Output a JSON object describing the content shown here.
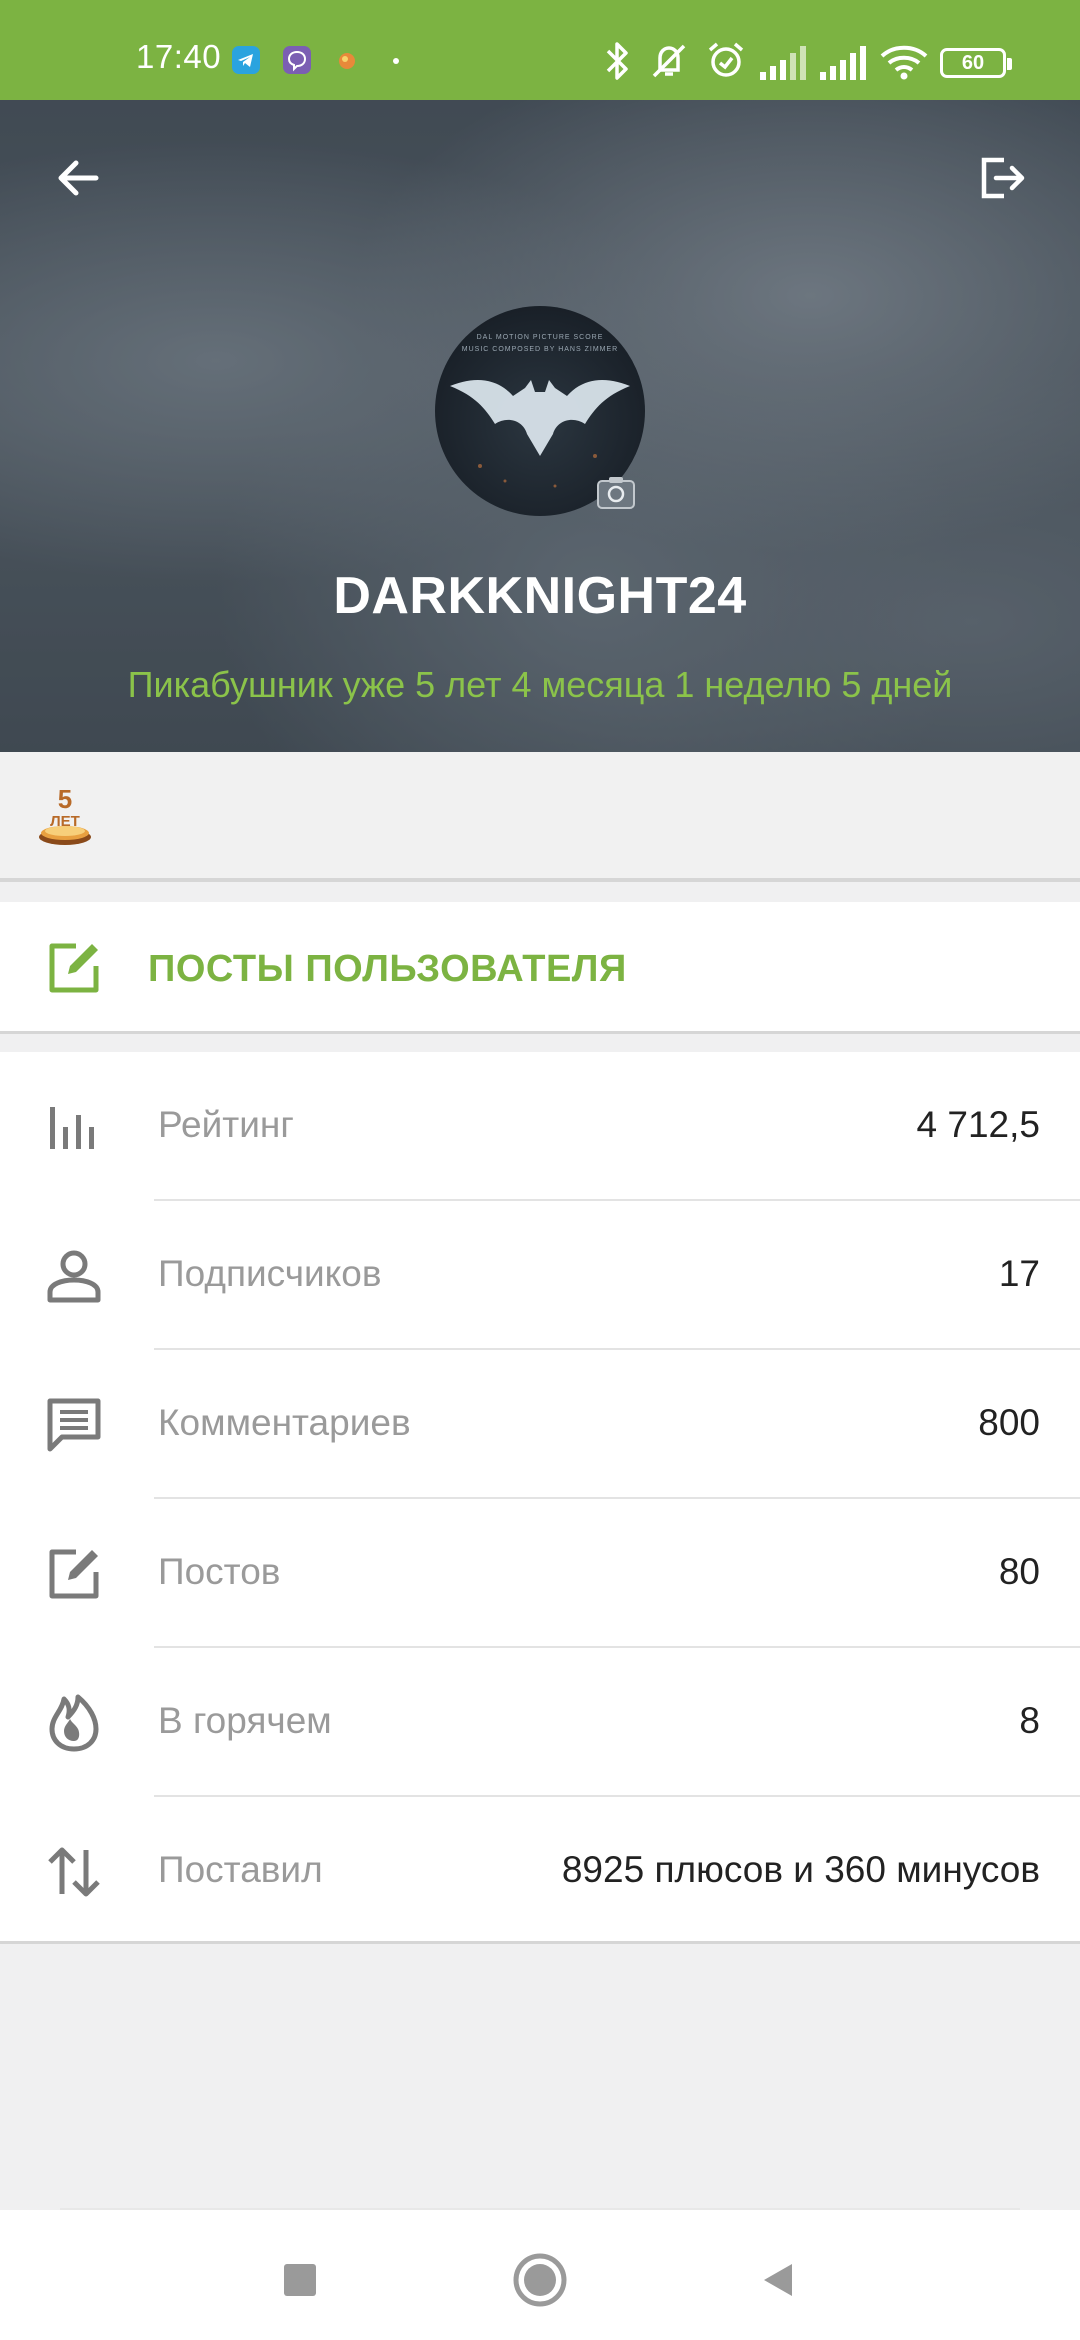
{
  "status_bar": {
    "time": "17:40",
    "battery": "60",
    "icons": [
      "telegram-icon",
      "viber-icon",
      "app-icon",
      "bluetooth-icon",
      "mute-icon",
      "alarm-icon",
      "signal-icon",
      "signal-icon",
      "wifi-icon"
    ]
  },
  "profile": {
    "username": "DARKKNIGHT24",
    "since": "Пикабушник уже 5 лет 4 месяца 1 неделю 5 дней",
    "avatar_text_top": "DAL MOTION PICTURE SCORE",
    "avatar_text_bottom": "MUSIC COMPOSED BY HANS ZIMMER"
  },
  "awards": {
    "badge_text_top": "5",
    "badge_text_bottom": "ЛЕТ"
  },
  "posts_link": {
    "label": "ПОСТЫ ПОЛЬЗОВАТЕЛЯ"
  },
  "stats": [
    {
      "icon": "rating-icon",
      "label": "Рейтинг",
      "value": "4 712,5"
    },
    {
      "icon": "person-icon",
      "label": "Подписчиков",
      "value": "17"
    },
    {
      "icon": "comment-icon",
      "label": "Комментариев",
      "value": "800"
    },
    {
      "icon": "edit-icon",
      "label": "Постов",
      "value": "80"
    },
    {
      "icon": "fire-icon",
      "label": "В горячем",
      "value": "8"
    },
    {
      "icon": "sort-icon",
      "label": "Поставил",
      "value": "8925 плюсов и 360 минусов"
    }
  ],
  "colors": {
    "accent": "#7cb342",
    "accent_light": "#8bc34a",
    "icon_gray": "#7a7a7a"
  }
}
